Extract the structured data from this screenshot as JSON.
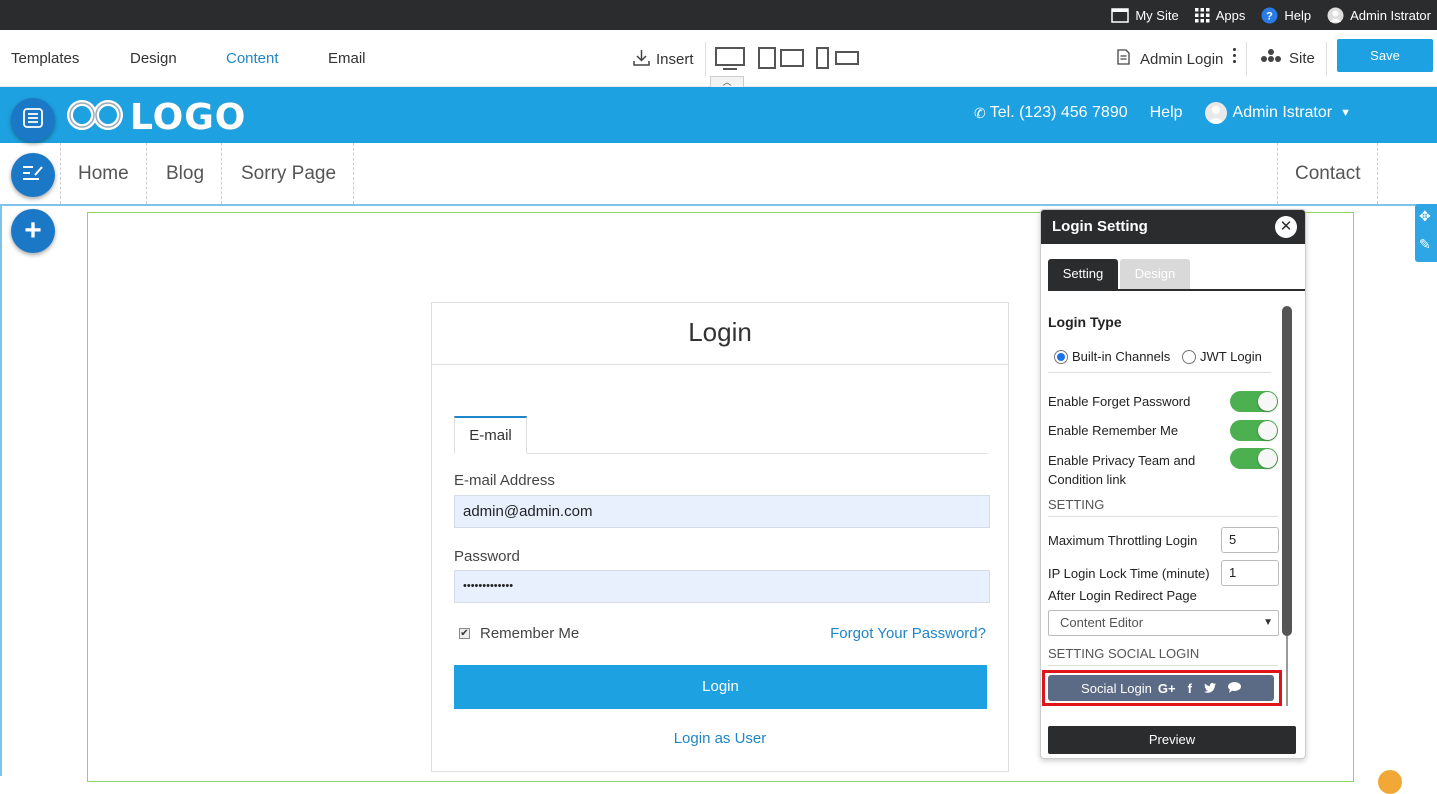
{
  "topbar": {
    "my_site": "My Site",
    "apps": "Apps",
    "help": "Help",
    "user": "Admin Istrator"
  },
  "toolbar": {
    "tabs": [
      "Templates",
      "Design",
      "Content",
      "Email"
    ],
    "active_tab": "Content",
    "insert": "Insert",
    "admin_login": "Admin Login",
    "site": "Site",
    "save": "Save"
  },
  "header": {
    "logo": "LOGO",
    "tel": "Tel. (123) 456 7890",
    "help": "Help",
    "user": "Admin Istrator"
  },
  "nav": {
    "items": [
      "Home",
      "Blog",
      "Sorry Page"
    ],
    "right_item": "Contact"
  },
  "login": {
    "title": "Login",
    "tab": "E-mail",
    "email_label": "E-mail Address",
    "email_value": "admin@admin.com",
    "password_label": "Password",
    "password_value": "•••••••••••••",
    "remember": "Remember Me",
    "forgot": "Forgot Your Password?",
    "login_button": "Login",
    "login_as_user": "Login as User"
  },
  "panel": {
    "title": "Login Setting",
    "tabs": [
      "Setting",
      "Design"
    ],
    "login_type_title": "Login Type",
    "radio_builtin": "Built-in Channels",
    "radio_jwt": "JWT Login",
    "selected_radio": "Built-in Channels",
    "toggles": [
      {
        "label": "Enable Forget Password",
        "on": true
      },
      {
        "label": "Enable Remember Me",
        "on": true
      },
      {
        "label": "Enable Privacy Team and Condition link",
        "on": true
      }
    ],
    "setting_section": "SETTING",
    "max_throttling_label": "Maximum Throttling Login",
    "max_throttling_value": "5",
    "ip_lock_label": "IP Login Lock Time (minute)",
    "ip_lock_value": "1",
    "redirect_label": "After Login Redirect Page",
    "redirect_value": "Content Editor",
    "social_section": "SETTING SOCIAL LOGIN",
    "social_button": "Social Login",
    "social_icons": [
      "google-plus-icon",
      "facebook-icon",
      "twitter-icon",
      "chat-icon"
    ],
    "preview": "Preview"
  },
  "colors": {
    "accent": "#1ea1e0",
    "dark": "#2b2c2e",
    "highlight": "#e0141b",
    "toggle_on": "#4caf50"
  }
}
